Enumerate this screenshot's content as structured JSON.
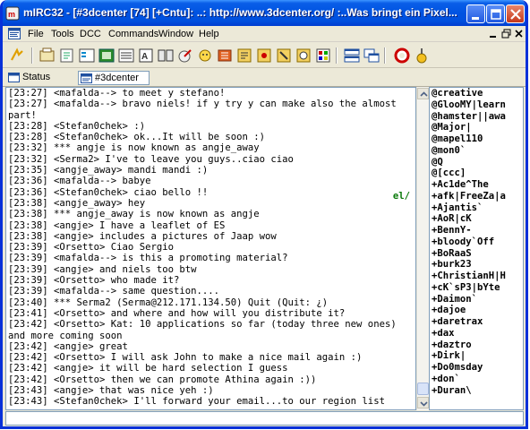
{
  "window": {
    "title": "mIRC32 - [#3dcenter [74] [+Cntu]: ..: http://www.3dcenter.org/ :..Was bringt ein Pixel...",
    "minimize_label": "minimize",
    "maximize_label": "maximize",
    "close_label": "close"
  },
  "menu": {
    "items": [
      "File",
      "Tools",
      "DCC",
      "Commands",
      "Window",
      "Help"
    ]
  },
  "switchbar": {
    "tabs": [
      "Status",
      "#3dcenter"
    ]
  },
  "chat": {
    "lines": [
      "[23:27] <mafalda--> to meet y stefano!",
      "[23:27] <mafalda--> bravo niels! if y try y can make also the almost part!",
      "[23:28] <Stefan0chek> :)",
      "[23:28] <Stefan0chek> ok...It will be soon :)",
      "[23:32] *** angje is now known as angje_away",
      "[23:32] <Serma2> I've to leave you guys..ciao ciao",
      "[23:35] <angje_away> mandi mandi :)",
      "[23:36] <mafalda--> babye",
      "[23:36] <Stefan0chek> ciao bello !!",
      "[23:38] <angje_away> hey",
      "[23:38] *** angje_away is now known as angje",
      "[23:38] <angje> I have a leaflet of ES",
      "[23:38] <angje> includes a pictures of Jaap wow",
      "[23:39] <Orsetto> Ciao Sergio",
      "[23:39] <mafalda--> is this a promoting material?",
      "[23:39] <angje> and niels too btw",
      "[23:39] <Orsetto> who made it?",
      "[23:39] <mafalda--> same question....",
      "[23:40] *** Serma2 (Serma@212.171.134.50) Quit (Quit: ¿)",
      "[23:41] <Orsetto> and where and how will you distribute it?",
      "[23:42] <Orsetto> Kat: 10 applications so far (today three new ones) and more coming soon",
      "[23:42] <angje> great",
      "[23:42] <Orsetto> I will ask John to make a nice mail again :)",
      "[23:42] <angje> it will be hard selection I guess",
      "[23:42] <Orsetto> then we can promote Athina again :))",
      "[23:43] <angje> that was nice yeh :)",
      "[23:43] <Stefan0chek> I'll forward your email...to our region list gunnar...."
    ],
    "overlay_fragment": "el/"
  },
  "nicklist": {
    "nicks": [
      "@creative",
      "@GlooMY|learn",
      "@hamster||awa",
      "@Major|",
      "@mapel110",
      "@mon0`",
      "@Q",
      "@[ccc]",
      "+Ac1de^The",
      "+afk|FreeZa|a",
      "+Ajantis`",
      "+AoR|cK",
      "+BennY-",
      "+bloody`Off",
      "+BoRaaS",
      "+burk23",
      "+ChristianH|H",
      "+cK`sP3|bYte",
      "+Daimon`",
      "+dajoe",
      "+daretrax",
      "+dax",
      "+daztro",
      "+Dirk|",
      "+Do0msday",
      "+don`",
      "+Duran\\"
    ]
  },
  "input": {
    "value": ""
  },
  "colors": {
    "titlebar": "#0053e1",
    "chrome": "#ece9d8",
    "border": "#7f9db9"
  }
}
